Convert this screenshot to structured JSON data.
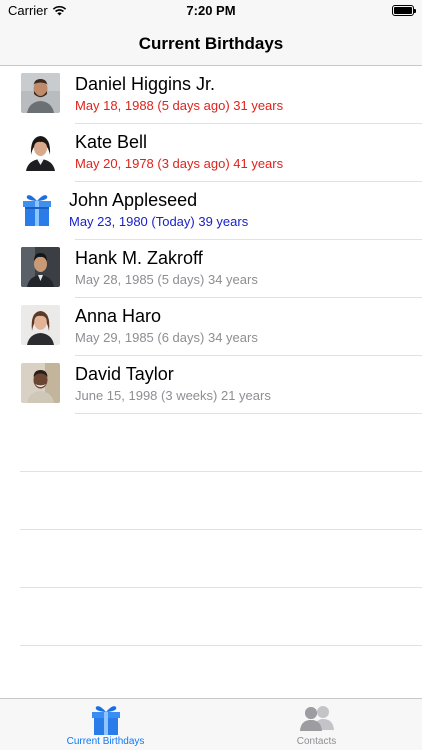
{
  "status_bar": {
    "carrier": "Carrier",
    "time": "7:20 PM"
  },
  "nav": {
    "title": "Current Birthdays"
  },
  "birthdays": [
    {
      "name": "Daniel Higgins Jr.",
      "detail": "May 18, 1988 (5 days ago) 31 years",
      "status": "past"
    },
    {
      "name": "Kate Bell",
      "detail": "May 20, 1978 (3 days ago) 41 years",
      "status": "past"
    },
    {
      "name": "John Appleseed",
      "detail": "May 23, 1980 (Today) 39 years",
      "status": "today"
    },
    {
      "name": "Hank M. Zakroff",
      "detail": "May 28, 1985 (5 days) 34 years",
      "status": "upcoming"
    },
    {
      "name": "Anna Haro",
      "detail": "May 29, 1985 (6 days) 34 years",
      "status": "upcoming"
    },
    {
      "name": "David Taylor",
      "detail": "June 15, 1998 (3 weeks) 21 years",
      "status": "upcoming"
    }
  ],
  "tabs": [
    {
      "label": "Current Birthdays",
      "icon": "gift-icon",
      "active": true
    },
    {
      "label": "Contacts",
      "icon": "contacts-icon",
      "active": false
    }
  ],
  "colors": {
    "past": "#e0221b",
    "today": "#1a22c7",
    "upcoming": "#8e8e93",
    "tint": "#1079f5"
  }
}
